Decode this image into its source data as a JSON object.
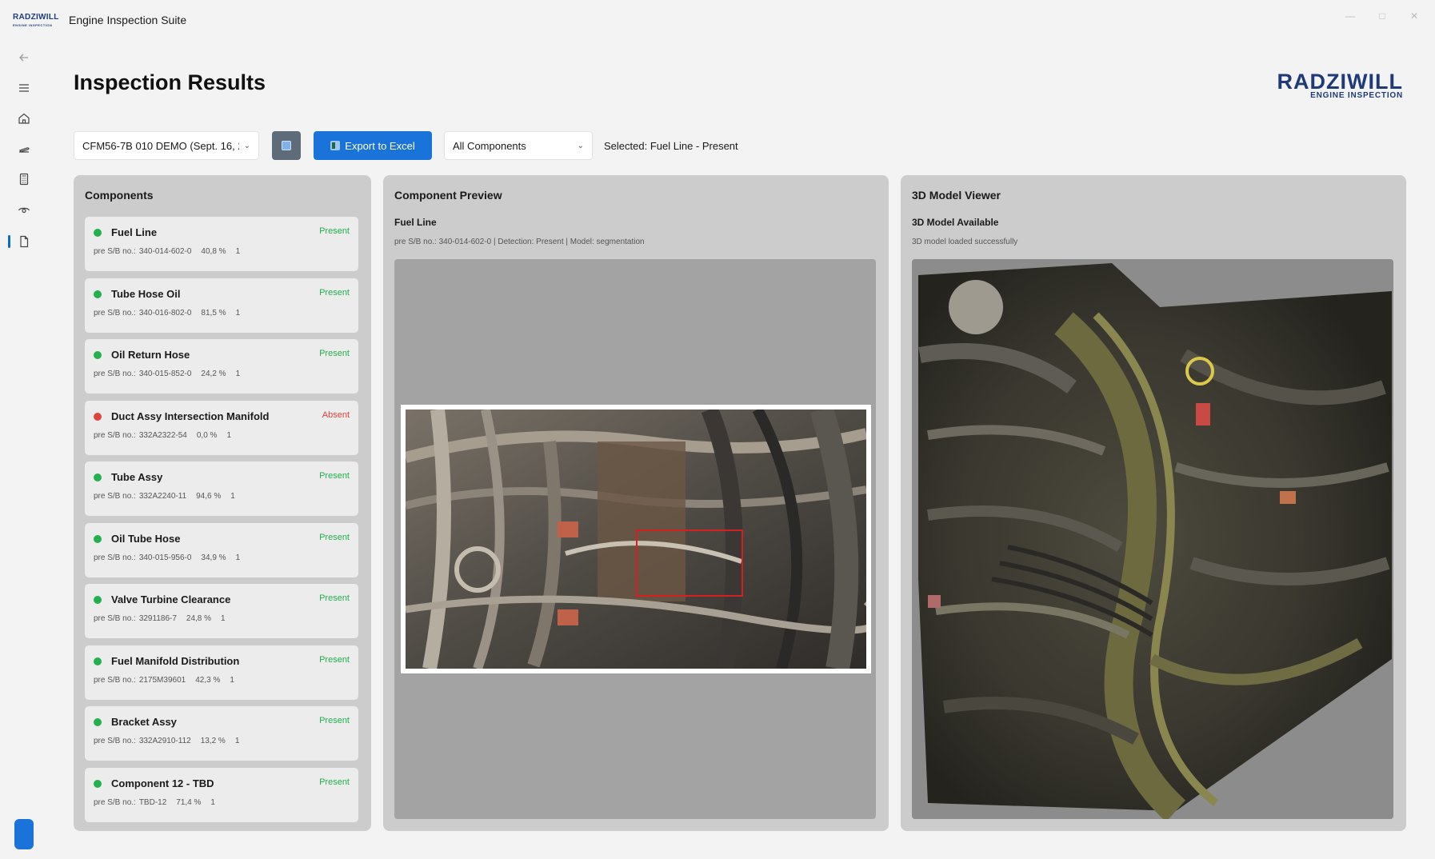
{
  "window": {
    "logo_text": "RADZIWILL",
    "logo_sub": "ENGINE INSPECTION",
    "title": "Engine Inspection Suite"
  },
  "page": {
    "title": "Inspection Results",
    "brand_name": "RADZIWILL",
    "brand_tag": "ENGINE INSPECTION"
  },
  "toolbar": {
    "inspection_select": "CFM56-7B 010 DEMO (Sept. 16, 2",
    "export_label": "Export to Excel",
    "filter_select": "All Components",
    "selected_text": "Selected: Fuel Line - Present"
  },
  "components_panel": {
    "title": "Components",
    "items": [
      {
        "name": "Fuel Line",
        "status": "Present",
        "part_label": "pre S/B no.:",
        "part": "340-014-602-0",
        "confidence": "40,8 %",
        "count": "1"
      },
      {
        "name": "Tube Hose Oil",
        "status": "Present",
        "part_label": "pre S/B no.:",
        "part": "340-016-802-0",
        "confidence": "81,5 %",
        "count": "1"
      },
      {
        "name": "Oil Return Hose",
        "status": "Present",
        "part_label": "pre S/B no.:",
        "part": "340-015-852-0",
        "confidence": "24,2 %",
        "count": "1"
      },
      {
        "name": "Duct Assy Intersection Manifold",
        "status": "Absent",
        "part_label": "pre S/B no.:",
        "part": "332A2322-54",
        "confidence": "0,0 %",
        "count": "1"
      },
      {
        "name": "Tube Assy",
        "status": "Present",
        "part_label": "pre S/B no.:",
        "part": "332A2240-11",
        "confidence": "94,6 %",
        "count": "1"
      },
      {
        "name": "Oil Tube Hose",
        "status": "Present",
        "part_label": "pre S/B no.:",
        "part": "340-015-956-0",
        "confidence": "34,9 %",
        "count": "1"
      },
      {
        "name": "Valve Turbine Clearance",
        "status": "Present",
        "part_label": "pre S/B no.:",
        "part": "3291186-7",
        "confidence": "24,8 %",
        "count": "1"
      },
      {
        "name": "Fuel Manifold Distribution",
        "status": "Present",
        "part_label": "pre S/B no.:",
        "part": "2175M39601",
        "confidence": "42,3 %",
        "count": "1"
      },
      {
        "name": "Bracket Assy",
        "status": "Present",
        "part_label": "pre S/B no.:",
        "part": "332A2910-112",
        "confidence": "13,2 %",
        "count": "1"
      },
      {
        "name": "Component 12 - TBD",
        "status": "Present",
        "part_label": "pre S/B no.:",
        "part": "TBD-12",
        "confidence": "71,4 %",
        "count": "1"
      }
    ]
  },
  "preview_panel": {
    "title": "Component Preview",
    "component": "Fuel Line",
    "meta": "pre S/B no.: 340-014-602-0 | Detection: Present | Model: segmentation"
  },
  "model_panel": {
    "title": "3D Model Viewer",
    "status_title": "3D Model Available",
    "status_text": "3D model loaded successfully"
  },
  "colors": {
    "accent": "#1a73d9",
    "present": "#22b14c",
    "absent": "#e0443e",
    "brand": "#1f3a7a"
  }
}
